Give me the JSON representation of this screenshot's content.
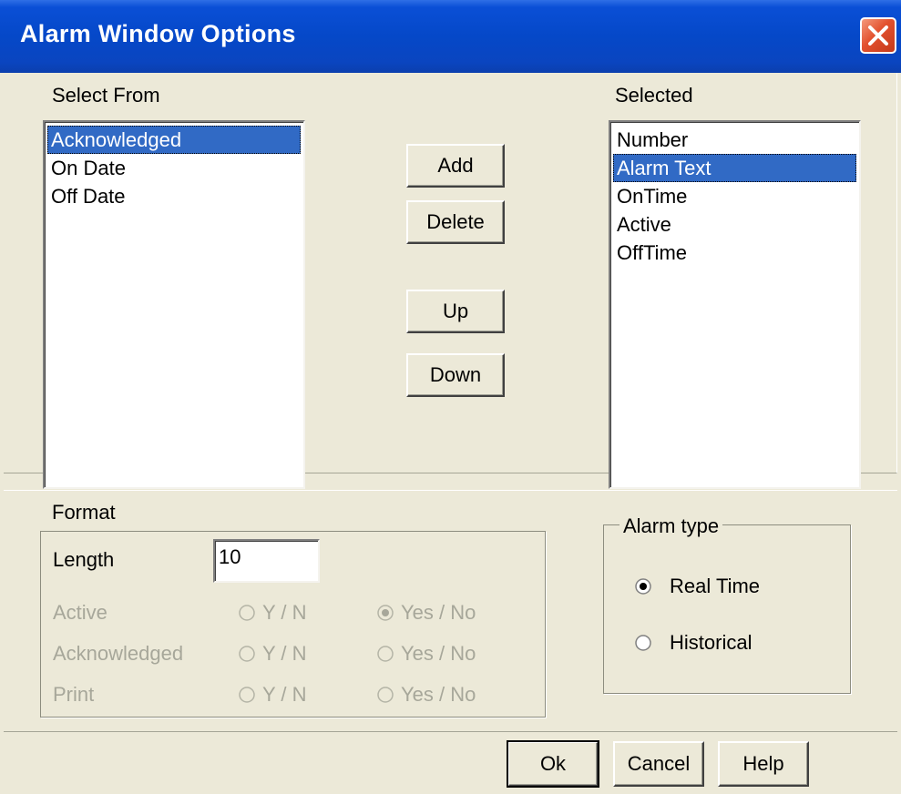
{
  "window": {
    "title": "Alarm Window Options",
    "close_icon": "close-icon"
  },
  "select_from": {
    "label": "Select From",
    "items": [
      "Acknowledged",
      "On Date",
      "Off Date"
    ],
    "selected_index": 0
  },
  "selected": {
    "label": "Selected",
    "items": [
      "Number",
      "Alarm Text",
      "OnTime",
      "Active",
      "OffTime"
    ],
    "selected_index": 1
  },
  "buttons": {
    "add": "Add",
    "delete": "Delete",
    "up": "Up",
    "down": "Down",
    "ok": "Ok",
    "cancel": "Cancel",
    "help": "Help"
  },
  "format": {
    "label": "Format",
    "length_label": "Length",
    "length_value": "10",
    "rows": [
      {
        "label": "Active",
        "opt1": "Y / N",
        "opt2": "Yes / No",
        "selected": "opt2"
      },
      {
        "label": "Acknowledged",
        "opt1": "Y / N",
        "opt2": "Yes / No",
        "selected": "none"
      },
      {
        "label": "Print",
        "opt1": "Y / N",
        "opt2": "Yes / No",
        "selected": "none"
      }
    ]
  },
  "alarm_type": {
    "label": "Alarm type",
    "options": [
      "Real Time",
      "Historical"
    ],
    "selected": "Real Time"
  },
  "colors": {
    "title_bar": "#0548c8",
    "selection": "#316ac5",
    "dialog_bg": "#ece9d8",
    "disabled_text": "#a7a79a"
  }
}
